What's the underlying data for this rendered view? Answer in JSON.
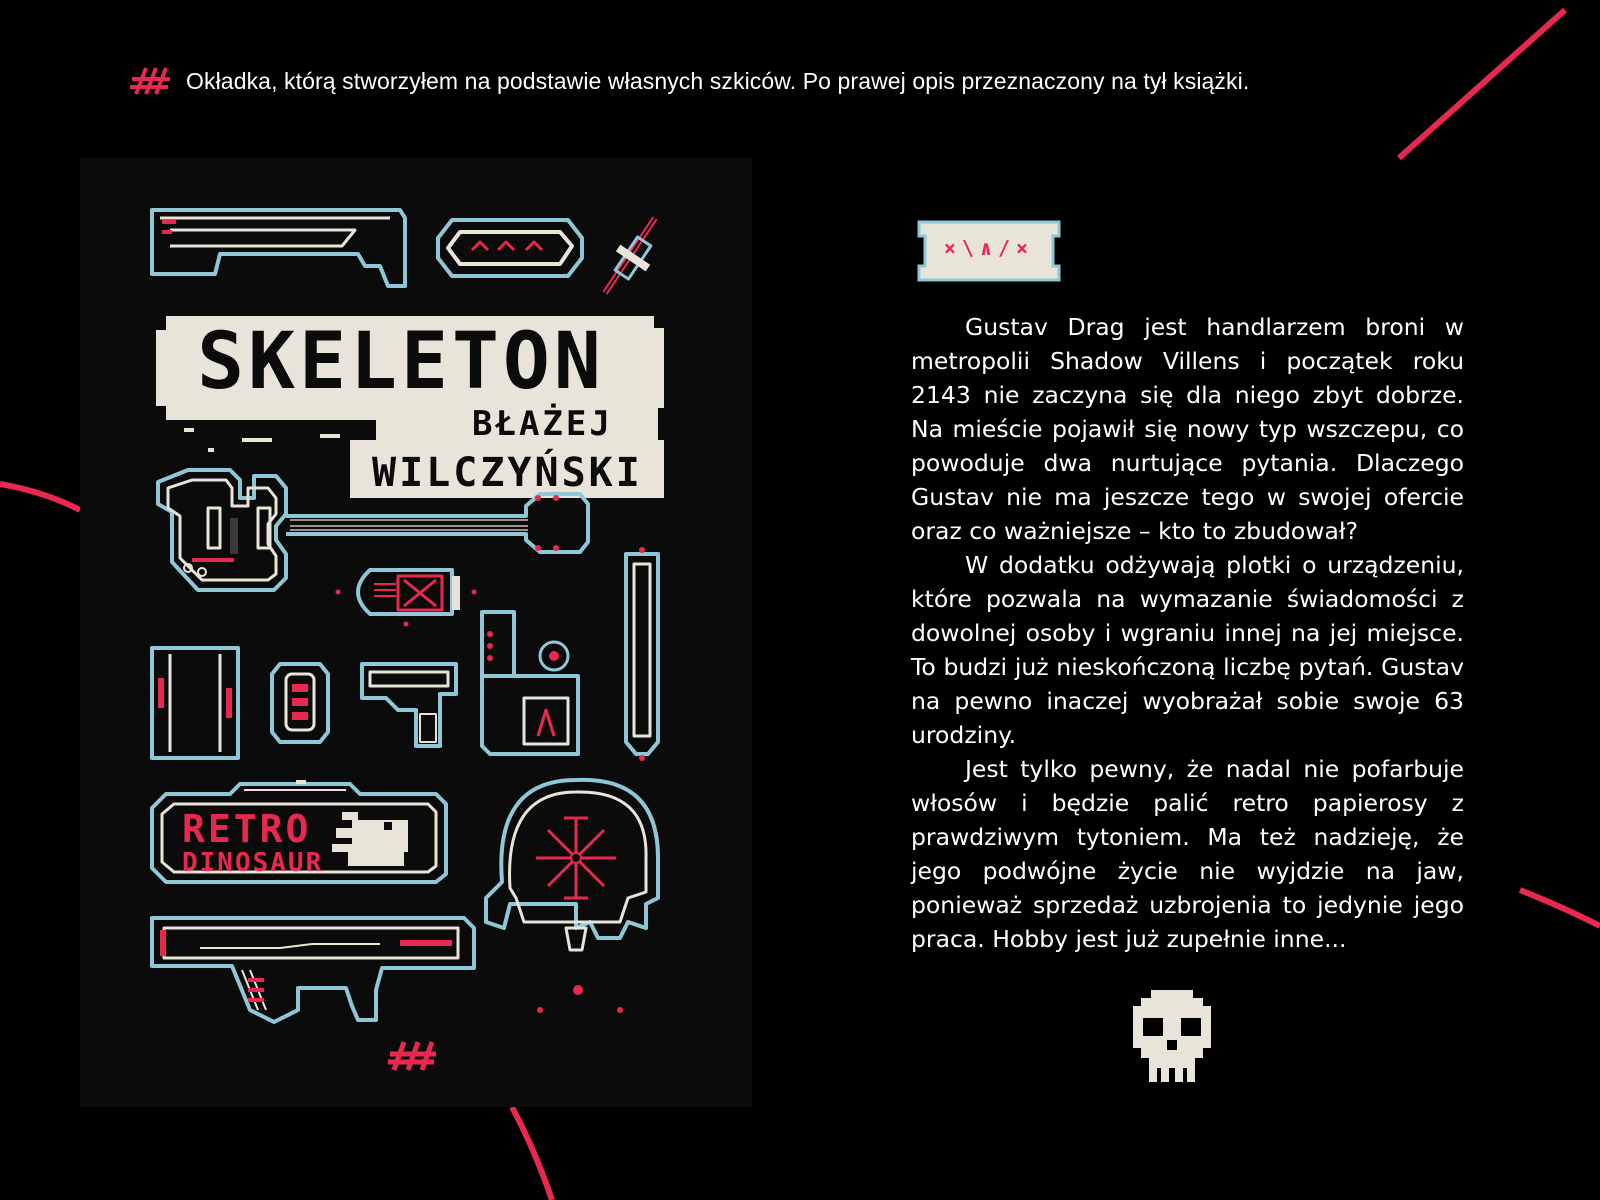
{
  "caption": {
    "text": "Okładka, którą stworzyłem na podstawie własnych szkiców. Po prawej opis przeznaczony na tył książki.",
    "icon": "hash-slashes-icon"
  },
  "cover": {
    "title": "SKELETON",
    "author_first": "BŁAŻEJ",
    "author_last": "WILCZYŃSKI",
    "badge_line1": "RETRO",
    "badge_line2": "DINOSAUR"
  },
  "description": {
    "plate_glyphs": "×\\∧/×",
    "paragraphs": [
      "Gustav Drag jest handlarzem broni w metropolii Shadow Villens i początek roku 2143 nie zaczyna się dla niego zbyt dobrze. Na mieście pojawił się nowy typ wszczepu, co powoduje dwa nurtujące pytania. Dlaczego Gustav nie ma jeszcze tego w swojej ofercie oraz co ważniejsze – kto to zbudował?",
      "W dodatku odżywają plotki o urządzeniu, które pozwala na wymazanie świadomości z dowolnej osoby i wgraniu innej na jej miejsce. To budzi już nieskończoną liczbę pytań. Gustav na pewno inaczej wyobrażał sobie swoje 63 urodziny.",
      "Jest tylko pewny, że nadal nie pofarbuje włosów i będzie palić retro papierosy z prawdziwym tytoniem. Ma też nadzieję, że jego podwójne życie nie wyjdzie na jaw, ponieważ sprzedaż uzbrojenia to jedynie jego praca. Hobby jest już zupełnie inne..."
    ]
  },
  "colors": {
    "background": "#000000",
    "accent": "#e8294f",
    "outline": "#8fc7d6",
    "cream": "#e9e4da"
  }
}
